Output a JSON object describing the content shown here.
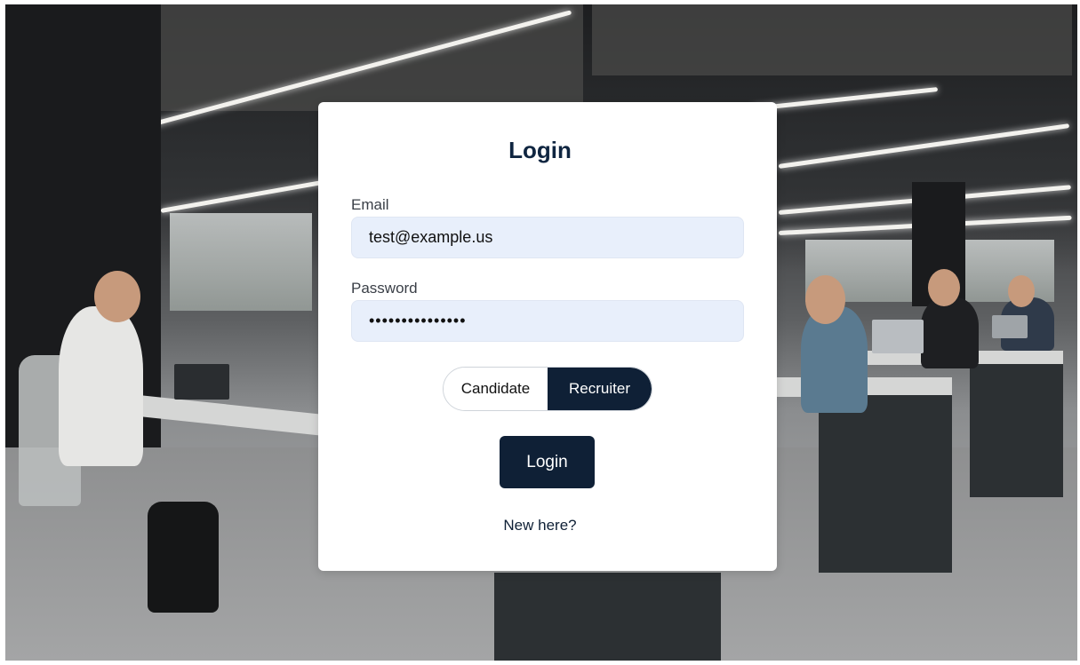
{
  "login": {
    "title": "Login",
    "email_label": "Email",
    "email_value": "test@example.us",
    "password_label": "Password",
    "password_value": "•••••••••••••••",
    "role_options": [
      "Candidate",
      "Recruiter"
    ],
    "selected_role": "Recruiter",
    "submit_label": "Login",
    "signup_link": "New here?"
  },
  "colors": {
    "primary": "#0f2036",
    "input_bg": "#e8effb",
    "title": "#0f2540"
  }
}
